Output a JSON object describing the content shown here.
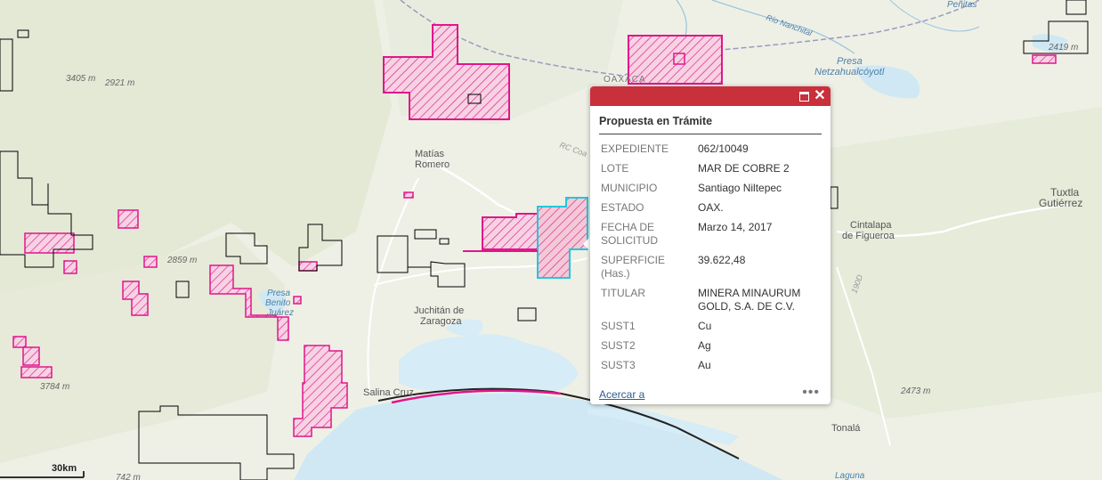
{
  "map": {
    "colors": {
      "land": "#eef0e6",
      "sea": "#cfe8f4",
      "concession_pending": "#e0168c",
      "concession_granted": "#000000",
      "selected": "#22c8dc",
      "state_border": "#9a9ac0"
    },
    "labels": {
      "oaxaca": "OAXACA",
      "matias_1": "Matías",
      "matias_2": "Romero",
      "juchitan_1": "Juchitán de",
      "juchitan_2": "Zaragoza",
      "salina_cruz": "Salina Cruz",
      "tuxtla_1": "Tuxtla",
      "tuxtla_2": "Gutiérrez",
      "cintalapa_1": "Cintalapa",
      "cintalapa_2": "de Figueroa",
      "tonala": "Tonalá",
      "presa_netza_1": "Presa",
      "presa_netza_2": "Netzahualcóyotl",
      "presa_benito_1": "Presa",
      "presa_benito_2": "Benito",
      "presa_benito_3": "Juárez",
      "rio_nanchital": "Río Nanchital",
      "penitas": "Peñitas",
      "laguna": "Laguna",
      "elev_3405": "3405 m",
      "elev_2921": "2921 m",
      "elev_2859": "2859 m",
      "elev_3784": "3784 m",
      "elev_742": "742 m",
      "elev_2419": "2419 m",
      "elev_2473": "2473 m",
      "road_190d": "190D",
      "road_rc": "RC Coa"
    }
  },
  "popup": {
    "title": "Propuesta en Trámite",
    "attributes": [
      {
        "key": "EXPEDIENTE",
        "value": "062/10049"
      },
      {
        "key": "LOTE",
        "value": "MAR DE COBRE 2"
      },
      {
        "key": "MUNICIPIO",
        "value": "Santiago Niltepec"
      },
      {
        "key": "ESTADO",
        "value": "OAX."
      },
      {
        "key": "FECHA DE SOLICITUD",
        "value": "Marzo 14, 2017"
      },
      {
        "key": "SUPERFICIE (Has.)",
        "value": "39.622,48"
      },
      {
        "key": "TITULAR",
        "value": "MINERA MINAURUM GOLD, S.A. DE C.V."
      },
      {
        "key": "SUST1",
        "value": "Cu"
      },
      {
        "key": "SUST2",
        "value": "Ag"
      },
      {
        "key": "SUST3",
        "value": "Au"
      }
    ],
    "zoom_label": "Acercar a",
    "more_label": "•••",
    "maximize_icon": "maximize-icon",
    "close_icon": "close-icon"
  },
  "scalebar": {
    "label": "30km"
  }
}
